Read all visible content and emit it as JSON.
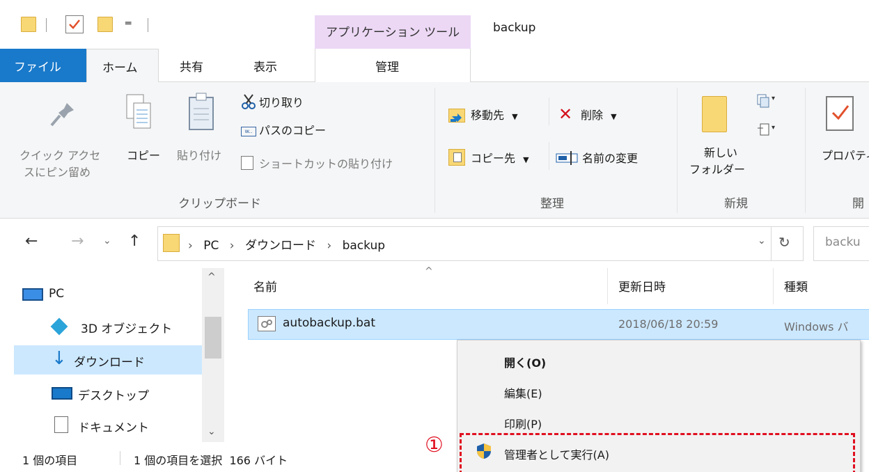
{
  "window": {
    "title": "backup",
    "contextual_tab_header": "アプリケーション ツール"
  },
  "ribbon_tabs": {
    "file": "ファイル",
    "home": "ホーム",
    "share": "共有",
    "view": "表示",
    "manage": "管理"
  },
  "clipboard": {
    "pin_label_1": "クイック アクセ",
    "pin_label_2": "スにピン留め",
    "copy": "コピー",
    "paste": "貼り付け",
    "cut": "切り取り",
    "copy_path": "パスのコピー",
    "paste_shortcut": "ショートカットの貼り付け",
    "group": "クリップボード"
  },
  "organize": {
    "move_to": "移動先",
    "delete": "削除",
    "copy_to": "コピー先",
    "rename": "名前の変更",
    "group": "整理"
  },
  "new": {
    "new_folder_1": "新しい",
    "new_folder_2": "フォルダー",
    "group": "新規"
  },
  "open": {
    "properties": "プロパティ",
    "group": "開"
  },
  "address": {
    "crumbs": [
      "PC",
      "ダウンロード",
      "backup"
    ],
    "search_placeholder": "backu"
  },
  "nav": {
    "items": [
      "PC",
      "3D オブジェクト",
      "ダウンロード",
      "デスクトップ",
      "ドキュメント"
    ]
  },
  "columns": {
    "name": "名前",
    "modified": "更新日時",
    "type": "種類"
  },
  "files": [
    {
      "name": "autobackup.bat",
      "modified": "2018/06/18 20:59",
      "type": "Windows バ"
    }
  ],
  "status": {
    "count": "1 個の項目",
    "selection": "1 個の項目を選択  166 バイト"
  },
  "context_menu": {
    "items": [
      "開く(O)",
      "編集(E)",
      "印刷(P)",
      "管理者として実行(A)"
    ]
  },
  "annotation": {
    "marker": "①"
  },
  "colors": {
    "file_tab": "#1979ca",
    "selection": "#cce8ff",
    "contextual_tab": "#ecd8f5",
    "annotation_red": "#e01020"
  }
}
